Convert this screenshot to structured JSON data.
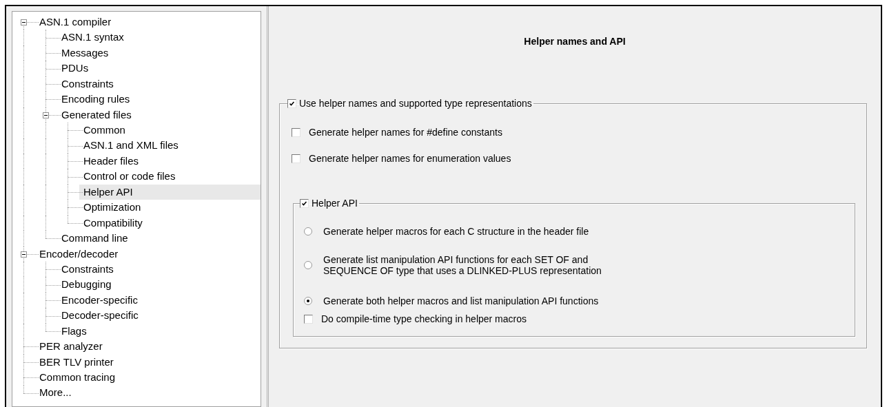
{
  "tree": [
    {
      "label": "ASN.1 compiler",
      "expanded": true,
      "selected": false,
      "children": [
        {
          "label": "ASN.1 syntax",
          "selected": false
        },
        {
          "label": "Messages",
          "selected": false
        },
        {
          "label": "PDUs",
          "selected": false
        },
        {
          "label": "Constraints",
          "selected": false
        },
        {
          "label": "Encoding rules",
          "selected": false
        },
        {
          "label": "Generated files",
          "expanded": true,
          "selected": false,
          "children": [
            {
              "label": "Common",
              "selected": false
            },
            {
              "label": "ASN.1 and XML files",
              "selected": false
            },
            {
              "label": "Header files",
              "selected": false
            },
            {
              "label": "Control or code files",
              "selected": false
            },
            {
              "label": "Helper API",
              "selected": true
            },
            {
              "label": "Optimization",
              "selected": false
            },
            {
              "label": "Compatibility",
              "selected": false
            }
          ]
        },
        {
          "label": "Command line",
          "selected": false
        }
      ]
    },
    {
      "label": "Encoder/decoder",
      "expanded": true,
      "selected": false,
      "children": [
        {
          "label": "Constraints",
          "selected": false
        },
        {
          "label": "Debugging",
          "selected": false
        },
        {
          "label": "Encoder-specific",
          "selected": false
        },
        {
          "label": "Decoder-specific",
          "selected": false
        },
        {
          "label": "Flags",
          "selected": false
        }
      ]
    },
    {
      "label": "PER analyzer",
      "selected": false
    },
    {
      "label": "BER TLV printer",
      "selected": false
    },
    {
      "label": "Common tracing",
      "selected": false
    },
    {
      "label": "More...",
      "selected": false
    }
  ],
  "panel": {
    "title": "Helper names and API",
    "group": {
      "label": "Use helper names and supported type representations",
      "checked": true,
      "options": [
        {
          "label": "Generate helper names for #define constants",
          "checked": false
        },
        {
          "label": "Generate helper names for enumeration values",
          "checked": false
        }
      ],
      "subgroup": {
        "label": "Helper API",
        "checked": true,
        "choices": [
          {
            "label": "Generate helper macros for each C structure in the header file",
            "selected": false
          },
          {
            "label": "Generate list manipulation API functions for each SET OF and\nSEQUENCE OF type that uses a DLINKED-PLUS representation",
            "selected": false
          },
          {
            "label": "Generate both helper macros and list manipulation API functions",
            "selected": true
          }
        ],
        "option": {
          "label": "Do compile-time type checking in helper macros",
          "checked": false
        }
      }
    }
  }
}
